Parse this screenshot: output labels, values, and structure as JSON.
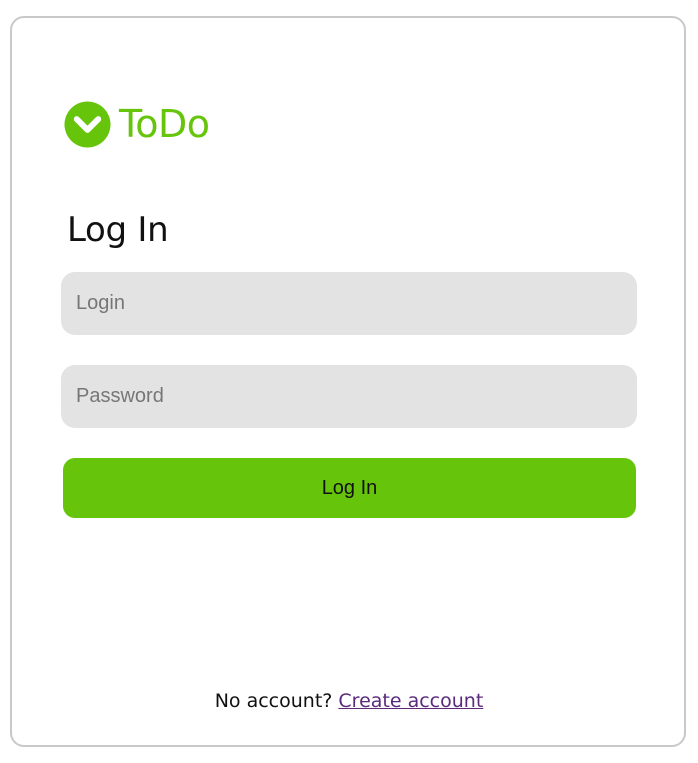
{
  "brand": {
    "name": "ToDo",
    "icon": "check-circle-icon",
    "color": "#66c40a"
  },
  "form": {
    "title": "Log In",
    "login_placeholder": "Login",
    "password_placeholder": "Password",
    "submit_label": "Log In"
  },
  "signup": {
    "prompt": "No account?",
    "link_label": "Create account",
    "link_color": "#5b2a7c"
  },
  "colors": {
    "accent": "#66c40a",
    "field_background": "#e3e3e3",
    "card_border": "#c9c9c9"
  }
}
